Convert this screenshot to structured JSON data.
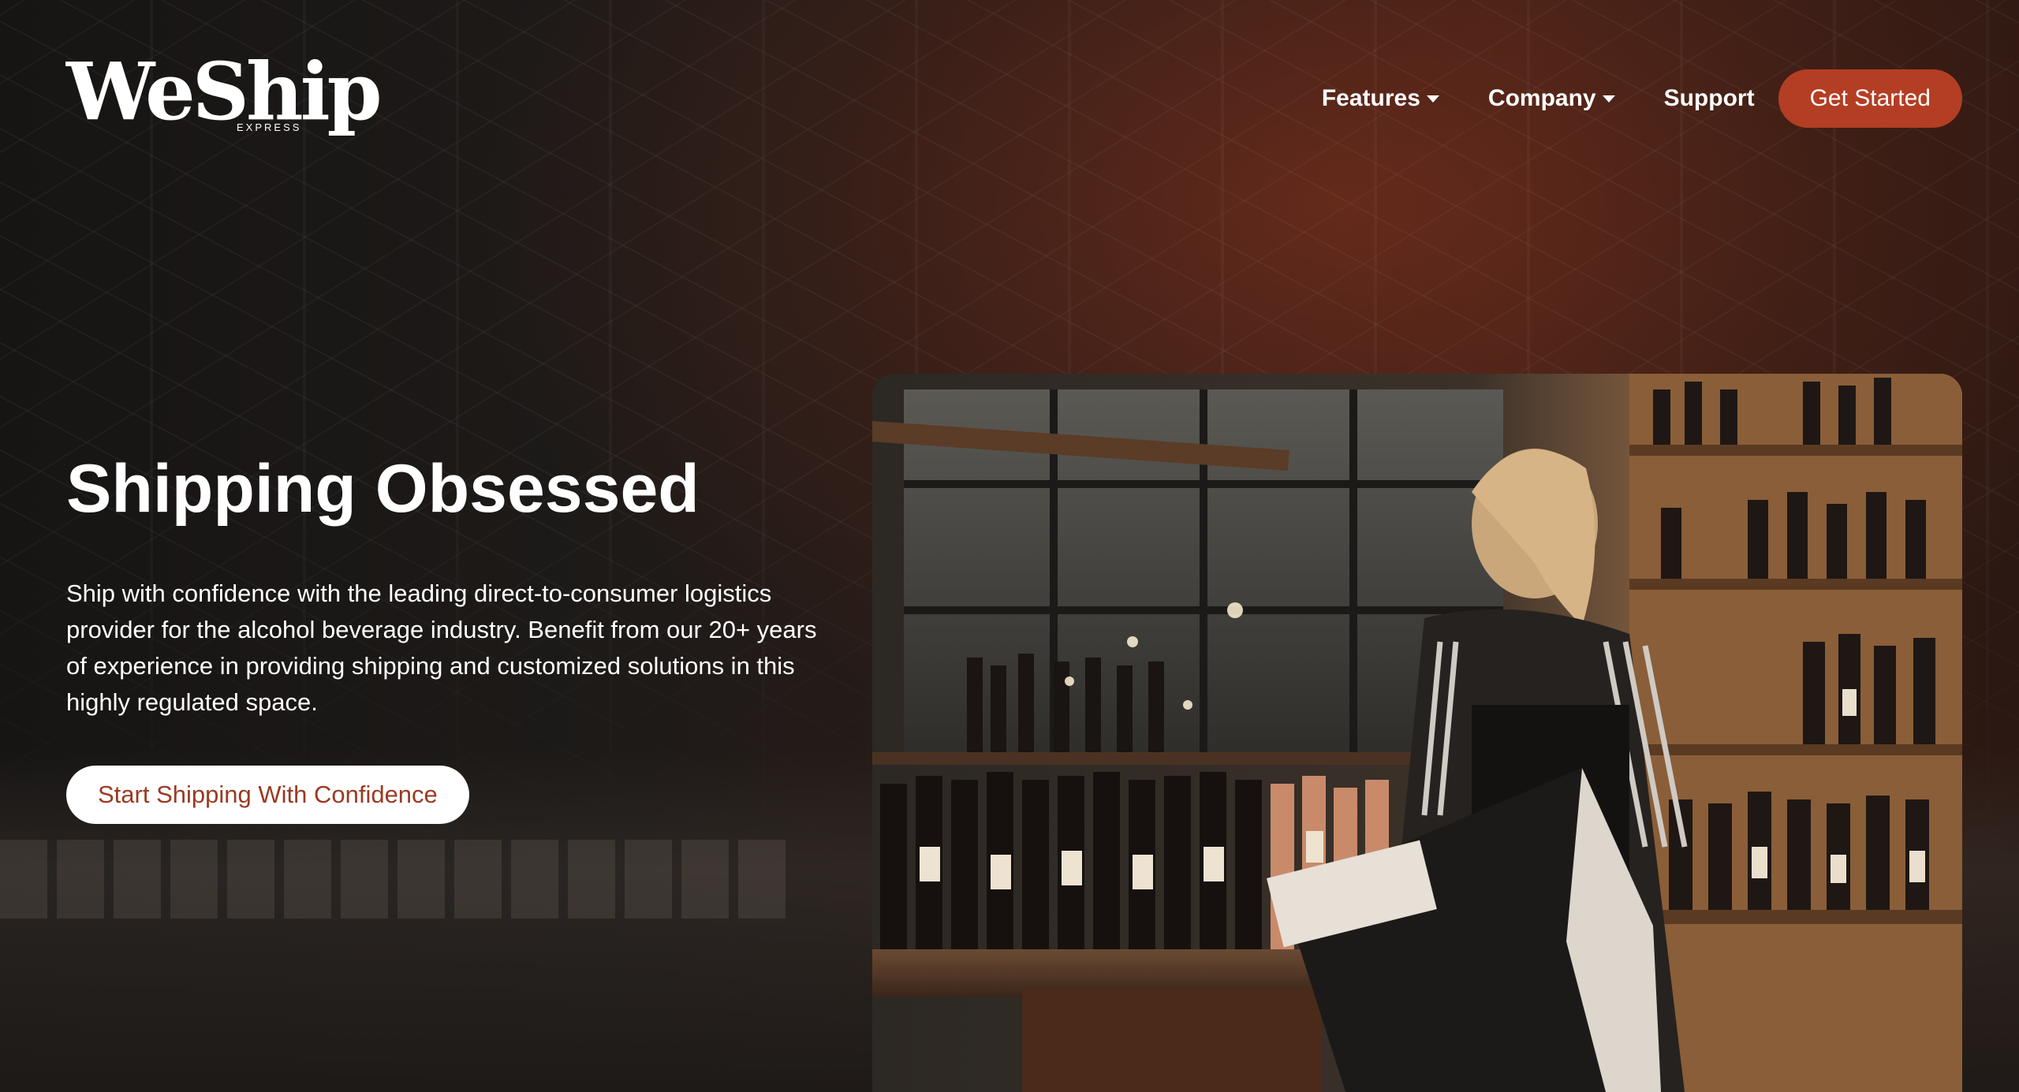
{
  "brand": {
    "logo_text": "WeShip",
    "logo_subtext": "EXPRESS"
  },
  "nav": {
    "items": [
      {
        "label": "Features",
        "has_dropdown": true
      },
      {
        "label": "Company",
        "has_dropdown": true
      },
      {
        "label": "Support",
        "has_dropdown": false
      }
    ],
    "cta_label": "Get Started"
  },
  "hero": {
    "title": "Shipping Obsessed",
    "description": "Ship with confidence with the leading direct-to-consumer logistics provider for the alcohol beverage industry. Benefit from our 20+ years of experience in providing shipping and customized solutions in this highly regulated space.",
    "cta_label": "Start Shipping With Confidence"
  },
  "colors": {
    "accent": "#b33e24",
    "cta_text": "#9a3a22",
    "background": "#1c1816"
  },
  "icons": {
    "dropdown": "caret-down-icon"
  }
}
